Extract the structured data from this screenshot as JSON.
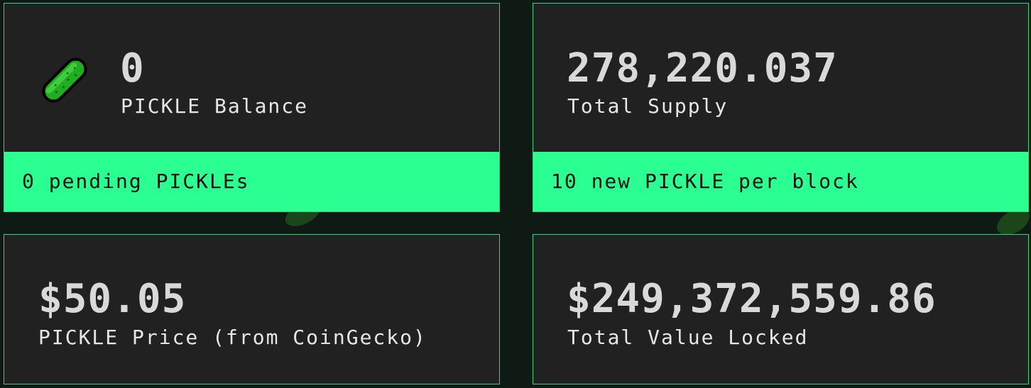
{
  "colors": {
    "page_background": "#0f1a15",
    "card_background": "#212121",
    "card_border": "#2bd87f",
    "footer_background": "#2cff92",
    "value_text": "#d9d9d9",
    "label_text": "#e6e6e6",
    "footer_text": "#111111"
  },
  "balance_card": {
    "icon": "pickle-icon",
    "value": "0",
    "label": "PICKLE Balance",
    "footer": "0 pending PICKLEs"
  },
  "supply_card": {
    "value": "278,220.037",
    "label": "Total Supply",
    "footer": "10 new PICKLE per block"
  },
  "price_card": {
    "value": "$50.05",
    "label": "PICKLE Price (from CoinGecko)"
  },
  "tvl_card": {
    "value": "$249,372,559.86",
    "label": "Total Value Locked"
  }
}
